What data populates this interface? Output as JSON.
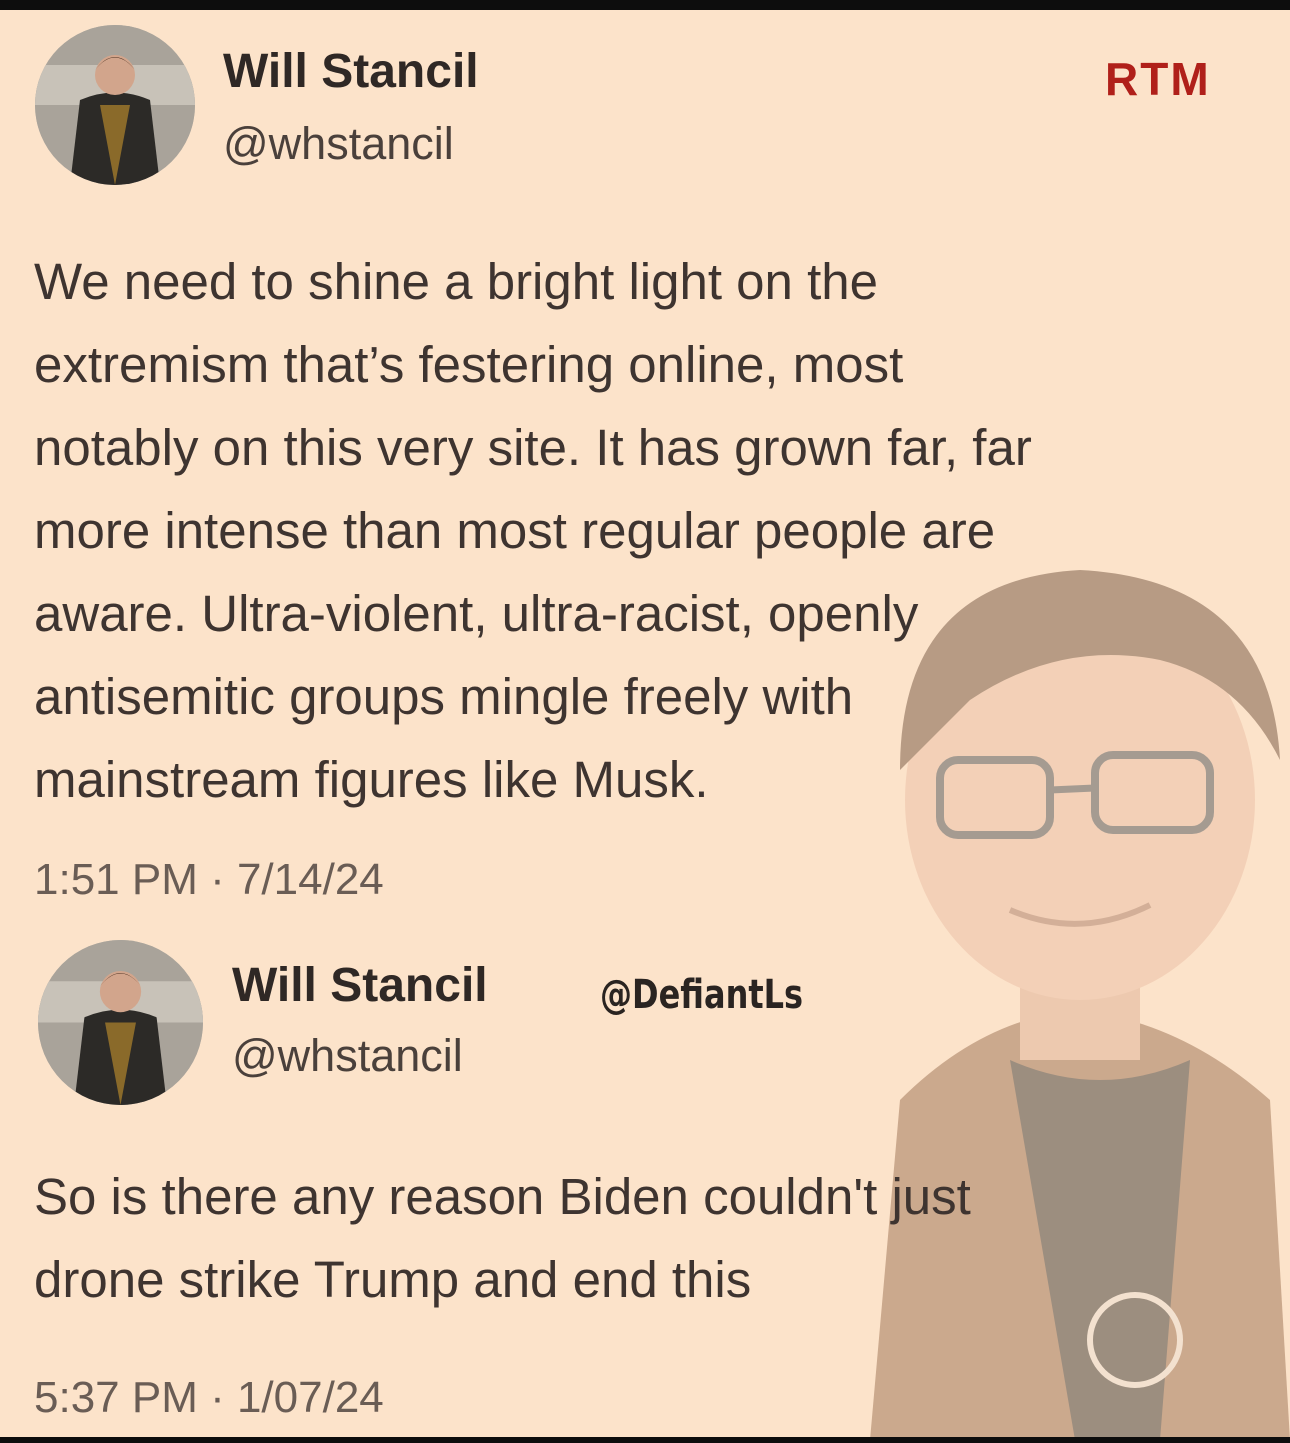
{
  "brand": {
    "rtm_label": "RTM",
    "rtm_color": "#b0201a"
  },
  "watermark": "@DefiantLs",
  "tweets": [
    {
      "name": "Will Stancil",
      "handle": "@whstancil",
      "text": "We need to shine a bright light on the\nextremism that’s festering online, most\nnotably on this very site. It has grown far, far\nmore intense than most regular people are\naware. Ultra-violent, ultra-racist, openly\nantisemitic groups mingle freely with\nmainstream figures like Musk.",
      "timestamp": "1:51 PM · 7/14/24"
    },
    {
      "name": "Will Stancil",
      "handle": "@whstancil",
      "text": "So is there any reason Biden couldn't just\ndrone strike Trump and end this",
      "timestamp": "5:37 PM · 1/07/24"
    }
  ],
  "icons": [
    "avatar-photo",
    "background-portrait"
  ],
  "colors": {
    "background": "#fce3ca",
    "text": "#3e3430",
    "muted": "#6a5d55"
  }
}
